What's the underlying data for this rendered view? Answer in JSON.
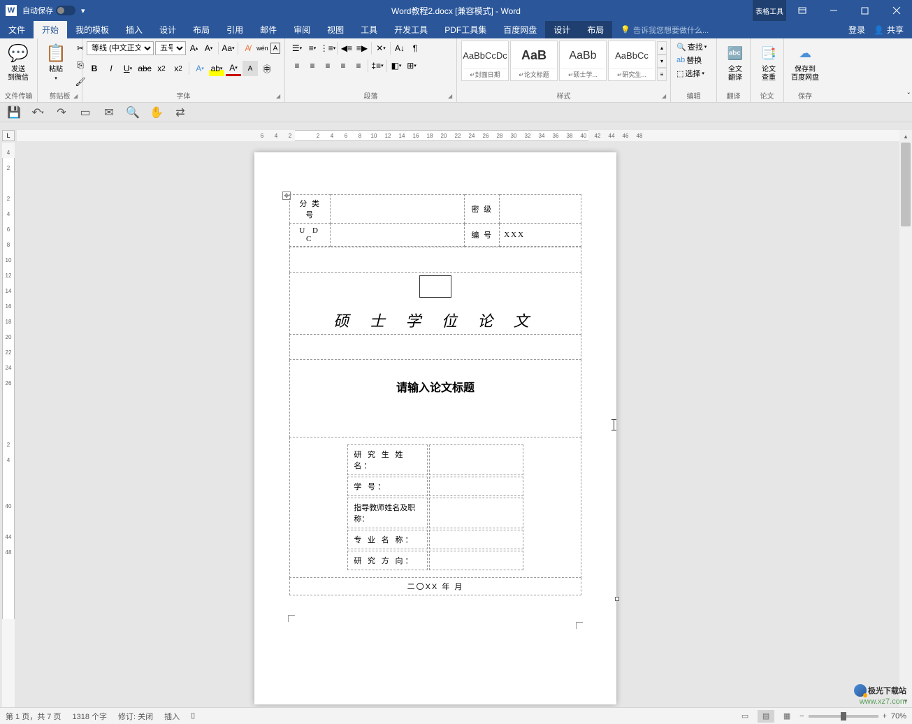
{
  "titlebar": {
    "autosave": "自动保存",
    "title": "Word教程2.docx [兼容模式] - Word",
    "table_tools": "表格工具",
    "design": "设计",
    "layout": "布局"
  },
  "menu": {
    "file": "文件",
    "home": "开始",
    "templates": "我的模板",
    "insert": "插入",
    "design": "设计",
    "layout": "布局",
    "references": "引用",
    "mailings": "邮件",
    "review": "审阅",
    "view": "视图",
    "tools": "工具",
    "dev": "开发工具",
    "pdf": "PDF工具集",
    "baidu": "百度网盘",
    "tell_me": "告诉我您想要做什么...",
    "login": "登录",
    "share": "共享"
  },
  "ribbon": {
    "wechat": {
      "label": "发送\n到微信",
      "group": "文件传输"
    },
    "clipboard": {
      "paste": "粘贴",
      "cut": "剪切",
      "copy": "复制",
      "format": "格式刷",
      "group": "剪贴板"
    },
    "font": {
      "name": "等线 (中文正文)",
      "size": "五号",
      "group": "字体"
    },
    "paragraph": {
      "group": "段落"
    },
    "styles": {
      "s1": "AaBbCcDc",
      "s1n": "↵封面日期",
      "s2": "AaB",
      "s2n": "↵论文标题",
      "s3": "AaBb",
      "s3n": "↵硕士学...",
      "s4": "AaBbCc",
      "s4n": "↵研究生...",
      "group": "样式"
    },
    "editing": {
      "find": "查找",
      "replace": "替换",
      "select": "选择",
      "group": "编辑"
    },
    "translate": {
      "label": "全文\n翻译",
      "group": "翻译"
    },
    "duplicate": {
      "label": "论文\n查重",
      "group": "论文"
    },
    "save": {
      "label": "保存到\n百度网盘",
      "group": "保存"
    }
  },
  "document": {
    "top_table": {
      "r1c1": "分 类 号",
      "r1c3": "密    级",
      "r2c1": "U D C",
      "r2c3": "编    号",
      "r2c4": "XXX"
    },
    "thesis_type": "硕  士  学  位  论  文",
    "title_placeholder": "请输入论文标题",
    "info": {
      "r1": "研  究  生 姓  名：",
      "r2": "学                号：",
      "r3": "指导教师姓名及职称：",
      "r4": "专    业    名    称：",
      "r5": "研    究    方    向："
    },
    "date": "二〇XX 年      月"
  },
  "ruler": {
    "h": [
      "6",
      "4",
      "2",
      "",
      "2",
      "4",
      "6",
      "8",
      "10",
      "12",
      "14",
      "16",
      "18",
      "20",
      "22",
      "24",
      "26",
      "28",
      "30",
      "32",
      "34",
      "36",
      "38",
      "40",
      "42",
      "44",
      "46",
      "48"
    ],
    "v": [
      "4",
      "2",
      "",
      "2",
      "4",
      "6",
      "8",
      "10",
      "12",
      "14",
      "16",
      "18",
      "20",
      "22",
      "24",
      "26",
      "",
      "",
      "",
      "2",
      "4",
      "",
      "",
      "40",
      "",
      "44",
      "48"
    ]
  },
  "status": {
    "page": "第 1 页，共 7 页",
    "words": "1318 个字",
    "track": "修订: 关闭",
    "insert": "插入",
    "zoom": "70%"
  },
  "watermark": {
    "name": "极光下载站",
    "url": "www.xz7.com"
  }
}
